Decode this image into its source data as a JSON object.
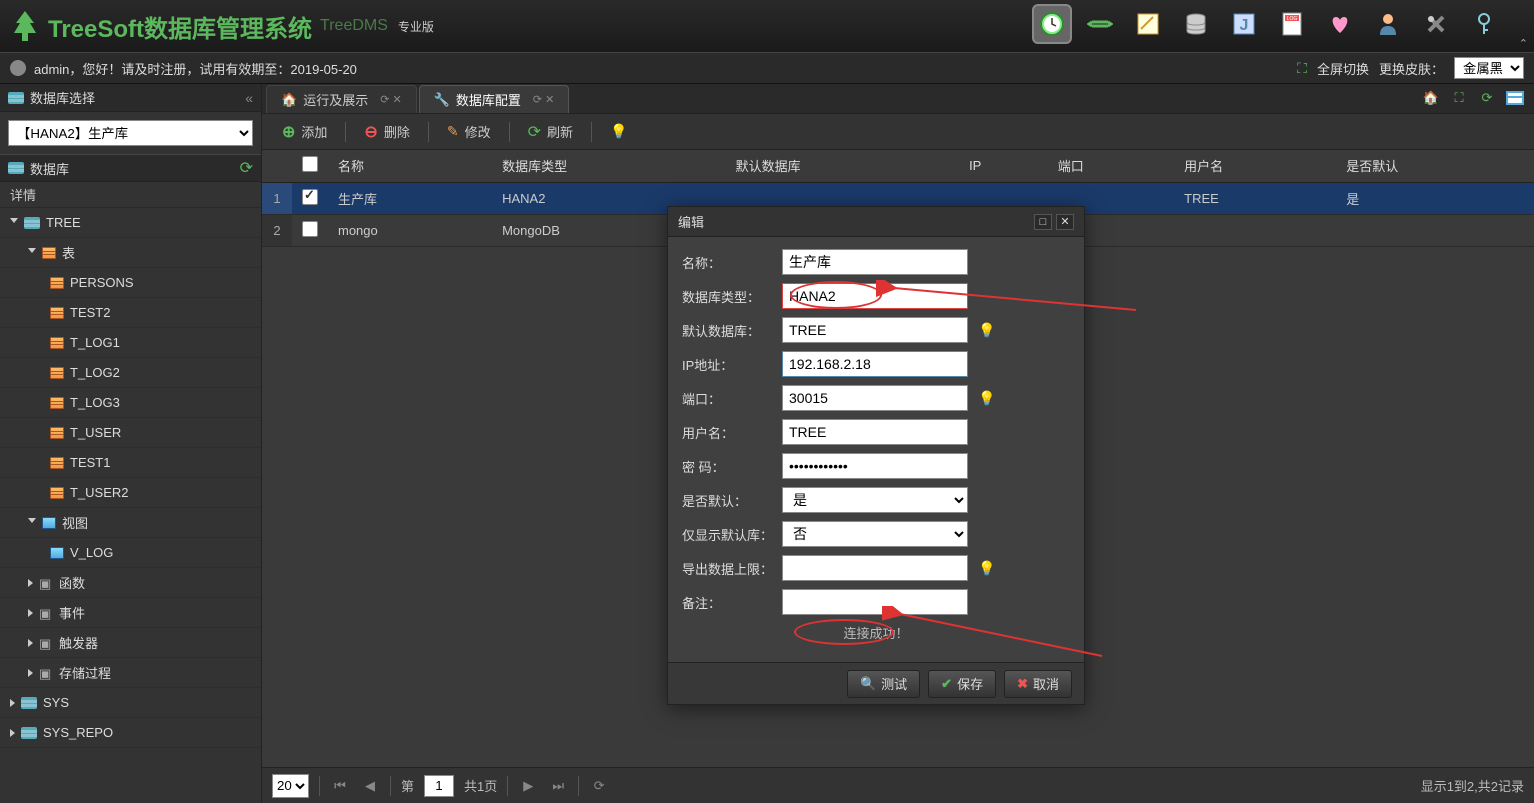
{
  "header": {
    "title": "TreeSoft数据库管理系统",
    "subtitle": "TreeDMS",
    "edition": "专业版"
  },
  "infobar": {
    "welcome": "admin，您好！请及时注册，试用有效期至：2019-05-20",
    "fullscreen": "全屏切换",
    "skin_label": "更换皮肤：",
    "skin_value": "金属黑"
  },
  "sidebar": {
    "title": "数据库选择",
    "db_select": "【HANA2】生产库",
    "section": "数据库",
    "detail": "详情",
    "tree": [
      {
        "label": "TREE",
        "type": "db",
        "level": 0,
        "open": true
      },
      {
        "label": "表",
        "type": "folder",
        "level": 1,
        "open": true,
        "icon": "tbl"
      },
      {
        "label": "PERSONS",
        "type": "table",
        "level": 2
      },
      {
        "label": "TEST2",
        "type": "table",
        "level": 2
      },
      {
        "label": "T_LOG1",
        "type": "table",
        "level": 2
      },
      {
        "label": "T_LOG2",
        "type": "table",
        "level": 2
      },
      {
        "label": "T_LOG3",
        "type": "table",
        "level": 2
      },
      {
        "label": "T_USER",
        "type": "table",
        "level": 2
      },
      {
        "label": "TEST1",
        "type": "table",
        "level": 2
      },
      {
        "label": "T_USER2",
        "type": "table",
        "level": 2
      },
      {
        "label": "视图",
        "type": "folder",
        "level": 1,
        "open": true,
        "icon": "view"
      },
      {
        "label": "V_LOG",
        "type": "view",
        "level": 2
      },
      {
        "label": "函数",
        "type": "fn",
        "level": 1
      },
      {
        "label": "事件",
        "type": "fn",
        "level": 1
      },
      {
        "label": "触发器",
        "type": "fn",
        "level": 1
      },
      {
        "label": "存储过程",
        "type": "fn",
        "level": 1
      },
      {
        "label": "SYS",
        "type": "db",
        "level": 0
      },
      {
        "label": "SYS_REPO",
        "type": "db",
        "level": 0
      }
    ]
  },
  "tabs": [
    {
      "label": "运行及展示",
      "icon": "home-red"
    },
    {
      "label": "数据库配置",
      "icon": "wrench",
      "active": true
    }
  ],
  "toolbar": {
    "add": "添加",
    "delete": "删除",
    "edit": "修改",
    "refresh": "刷新"
  },
  "grid": {
    "headers": [
      "名称",
      "数据库类型",
      "默认数据库",
      "IP",
      "端口",
      "用户名",
      "是否默认"
    ],
    "rows": [
      {
        "num": "1",
        "checked": true,
        "selected": true,
        "cells": [
          "生产库",
          "HANA2",
          "",
          "",
          "",
          "TREE",
          "是"
        ]
      },
      {
        "num": "2",
        "checked": false,
        "selected": false,
        "cells": [
          "mongo",
          "MongoDB",
          "",
          "",
          "",
          "",
          ""
        ]
      }
    ]
  },
  "footer": {
    "pagesize": "20",
    "page_label_pre": "第",
    "page": "1",
    "page_label_post": "共1页",
    "status": "显示1到2,共2记录"
  },
  "dialog": {
    "title": "编辑",
    "fields": {
      "name_label": "名称：",
      "name": "生产库",
      "dbtype_label": "数据库类型：",
      "dbtype": "HANA2",
      "defaultdb_label": "默认数据库：",
      "defaultdb": "TREE",
      "ip_label": "IP地址：",
      "ip": "192.168.2.18",
      "port_label": "端口：",
      "port": "30015",
      "user_label": "用户名：",
      "user": "TREE",
      "pwd_label": "密 码：",
      "pwd": "••••••••••••",
      "isdefault_label": "是否默认：",
      "isdefault": "是",
      "onlydefault_label": "仅显示默认库：",
      "onlydefault": "否",
      "exportlimit_label": "导出数据上限：",
      "exportlimit": "",
      "remark_label": "备注：",
      "remark": ""
    },
    "status": "连接成功！",
    "buttons": {
      "test": "测试",
      "save": "保存",
      "cancel": "取消"
    }
  }
}
